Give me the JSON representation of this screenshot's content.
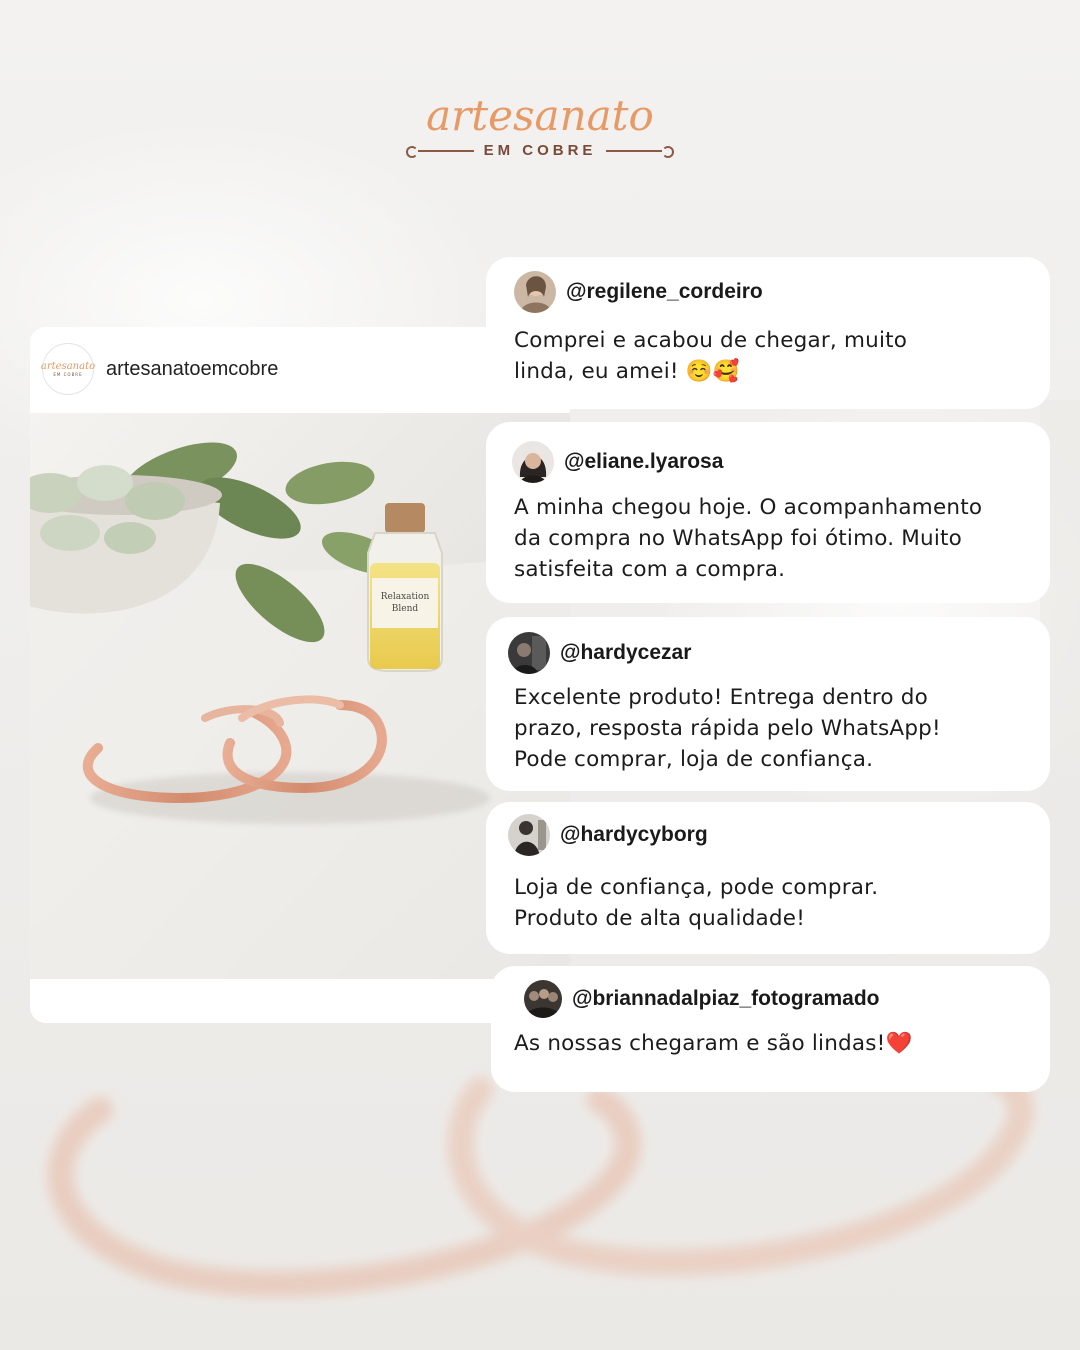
{
  "brand": {
    "logo_script": "artesanato",
    "logo_sub": "EM COBRE"
  },
  "post": {
    "username": "artesanatoemcobre",
    "avatar_script": "artesanato",
    "avatar_sub": "EM COBRE"
  },
  "comments": [
    {
      "user": "@regilene_cordeiro",
      "text": "Comprei e acabou de chegar, muito\nlinda, eu amei! ☺️🥰"
    },
    {
      "user": "@eliane.lyarosa",
      "text": "A minha chegou hoje. O acompanhamento\nda compra no WhatsApp foi ótimo. Muito\nsatisfeita com a compra."
    },
    {
      "user": "@hardycezar",
      "text": "Excelente produto! Entrega dentro do\nprazo, resposta rápida pelo WhatsApp!\nPode comprar, loja de confiança."
    },
    {
      "user": "@hardycyborg",
      "text": "Loja de confiança, pode comprar.\nProduto de alta qualidade!"
    },
    {
      "user": "@briannadalpiaz_fotogramado",
      "text": "As nossas chegaram e são lindas!❤️"
    }
  ],
  "photo": {
    "bottle_label_line1": "Relaxation",
    "bottle_label_line2": "Blend"
  },
  "colors": {
    "brand_orange": "#e79a66",
    "brand_brown": "#7a4a38",
    "copper": "#d9957a"
  }
}
